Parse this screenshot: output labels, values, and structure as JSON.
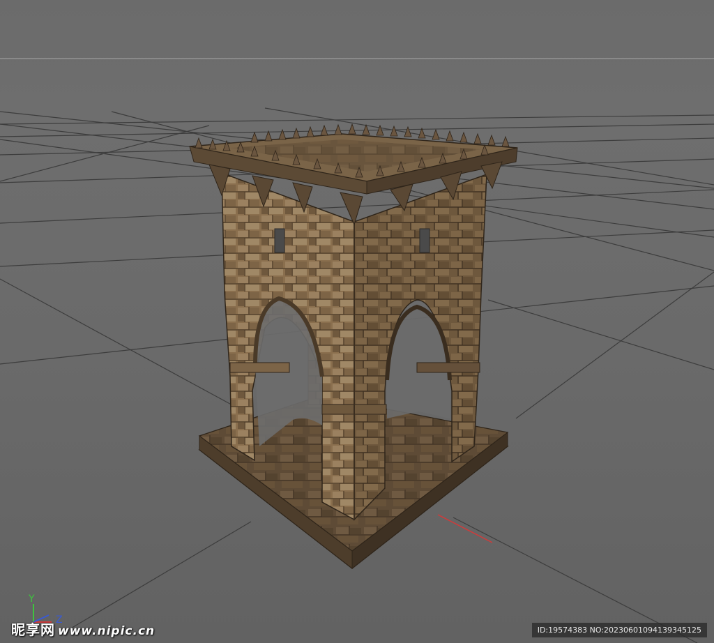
{
  "viewport": {
    "axis_labels": {
      "y": "Y",
      "z": "Z"
    },
    "colors": {
      "axis_y": "#3ec43e",
      "axis_x": "#d23a3a",
      "axis_z": "#3a5ad2",
      "grid": "#3c3c3c",
      "horizon": "#8a8a8a"
    }
  },
  "watermark": {
    "site_name": "昵享网",
    "site_url": "www.nipic.cn",
    "id_text": "ID:19574383 NO:20230601094139345125"
  }
}
